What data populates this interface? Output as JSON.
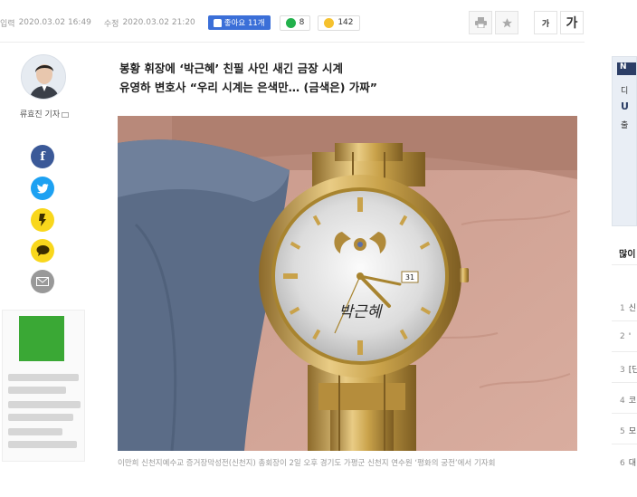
{
  "meta": {
    "input_label": "입력",
    "input_date": "2020.03.02 16:49",
    "edit_label": "수정",
    "edit_date": "2020.03.02 21:20",
    "like_label": "좋아요 11개",
    "comments": "8",
    "reactions": "142"
  },
  "toolbar": {
    "print_icon": "printer-icon",
    "bookmark_icon": "star-icon",
    "font_small": "가",
    "font_large": "가"
  },
  "author": {
    "name": "류효진 기자"
  },
  "share": {
    "facebook": "f",
    "twitter": "t",
    "kakaostory": "s",
    "kakaotalk": "k",
    "email": "@"
  },
  "article": {
    "headline_line1": "봉황 휘장에 ‘박근혜’ 친필 사인 새긴 금장 시계",
    "headline_line2": "유영하 변호사 “우리 시계는 은색만… (금색은) 가짜”",
    "caption": "이만희 신천지예수교 증거장막성전(신천지) 총회장이 2일 오후 경기도 가평군 신천지 연수원 ‘평화의 궁전’에서 기자회",
    "watch_date_window": "31",
    "watch_signature": "박근혜"
  },
  "rail": {
    "ad_badge": "N",
    "ad_line1": "디",
    "ad_line2": "U",
    "ad_line3": "출",
    "most_viewed_title": "많이",
    "items": [
      {
        "num": "1",
        "text": "신"
      },
      {
        "num": "2",
        "text": "'"
      },
      {
        "num": "3",
        "text": "[단"
      },
      {
        "num": "4",
        "text": "코"
      },
      {
        "num": "5",
        "text": "모"
      },
      {
        "num": "6",
        "text": "대"
      }
    ]
  },
  "colors": {
    "like_blue": "#3b6fd8",
    "facebook": "#3b5998",
    "twitter": "#1da1f2",
    "kakao_yellow": "#f9d71c",
    "gold": "#c9a24a"
  }
}
